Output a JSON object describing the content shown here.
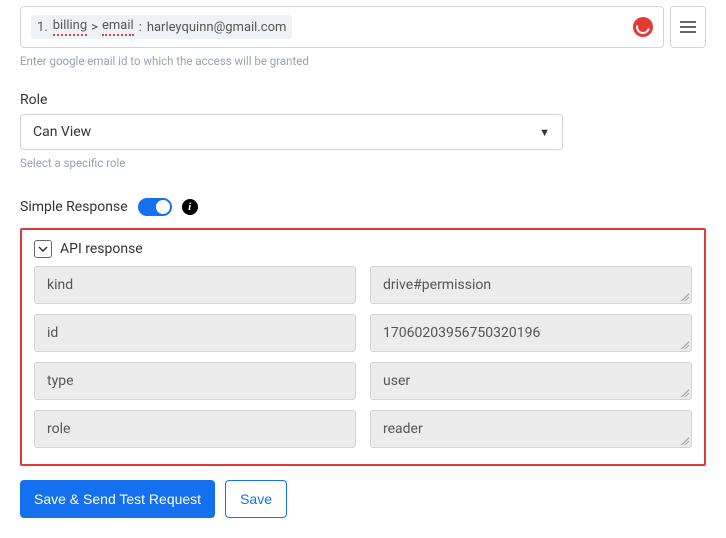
{
  "email_field": {
    "chip_number": "1.",
    "chip_part1": "billing",
    "chip_sep": ">",
    "chip_part2": "email",
    "chip_colon": ":",
    "chip_value": "harleyquinn@gmail.com",
    "hint": "Enter google email id to which the access will be granted"
  },
  "role": {
    "label": "Role",
    "selected": "Can View",
    "hint": "Select a specific role"
  },
  "simple_response": {
    "label": "Simple Response",
    "enabled": true
  },
  "api_response": {
    "title": "API response",
    "rows": [
      {
        "key": "kind",
        "value": "drive#permission"
      },
      {
        "key": "id",
        "value": "17060203956750320196"
      },
      {
        "key": "type",
        "value": "user"
      },
      {
        "key": "role",
        "value": "reader"
      }
    ]
  },
  "buttons": {
    "save_send": "Save & Send Test Request",
    "save": "Save"
  }
}
